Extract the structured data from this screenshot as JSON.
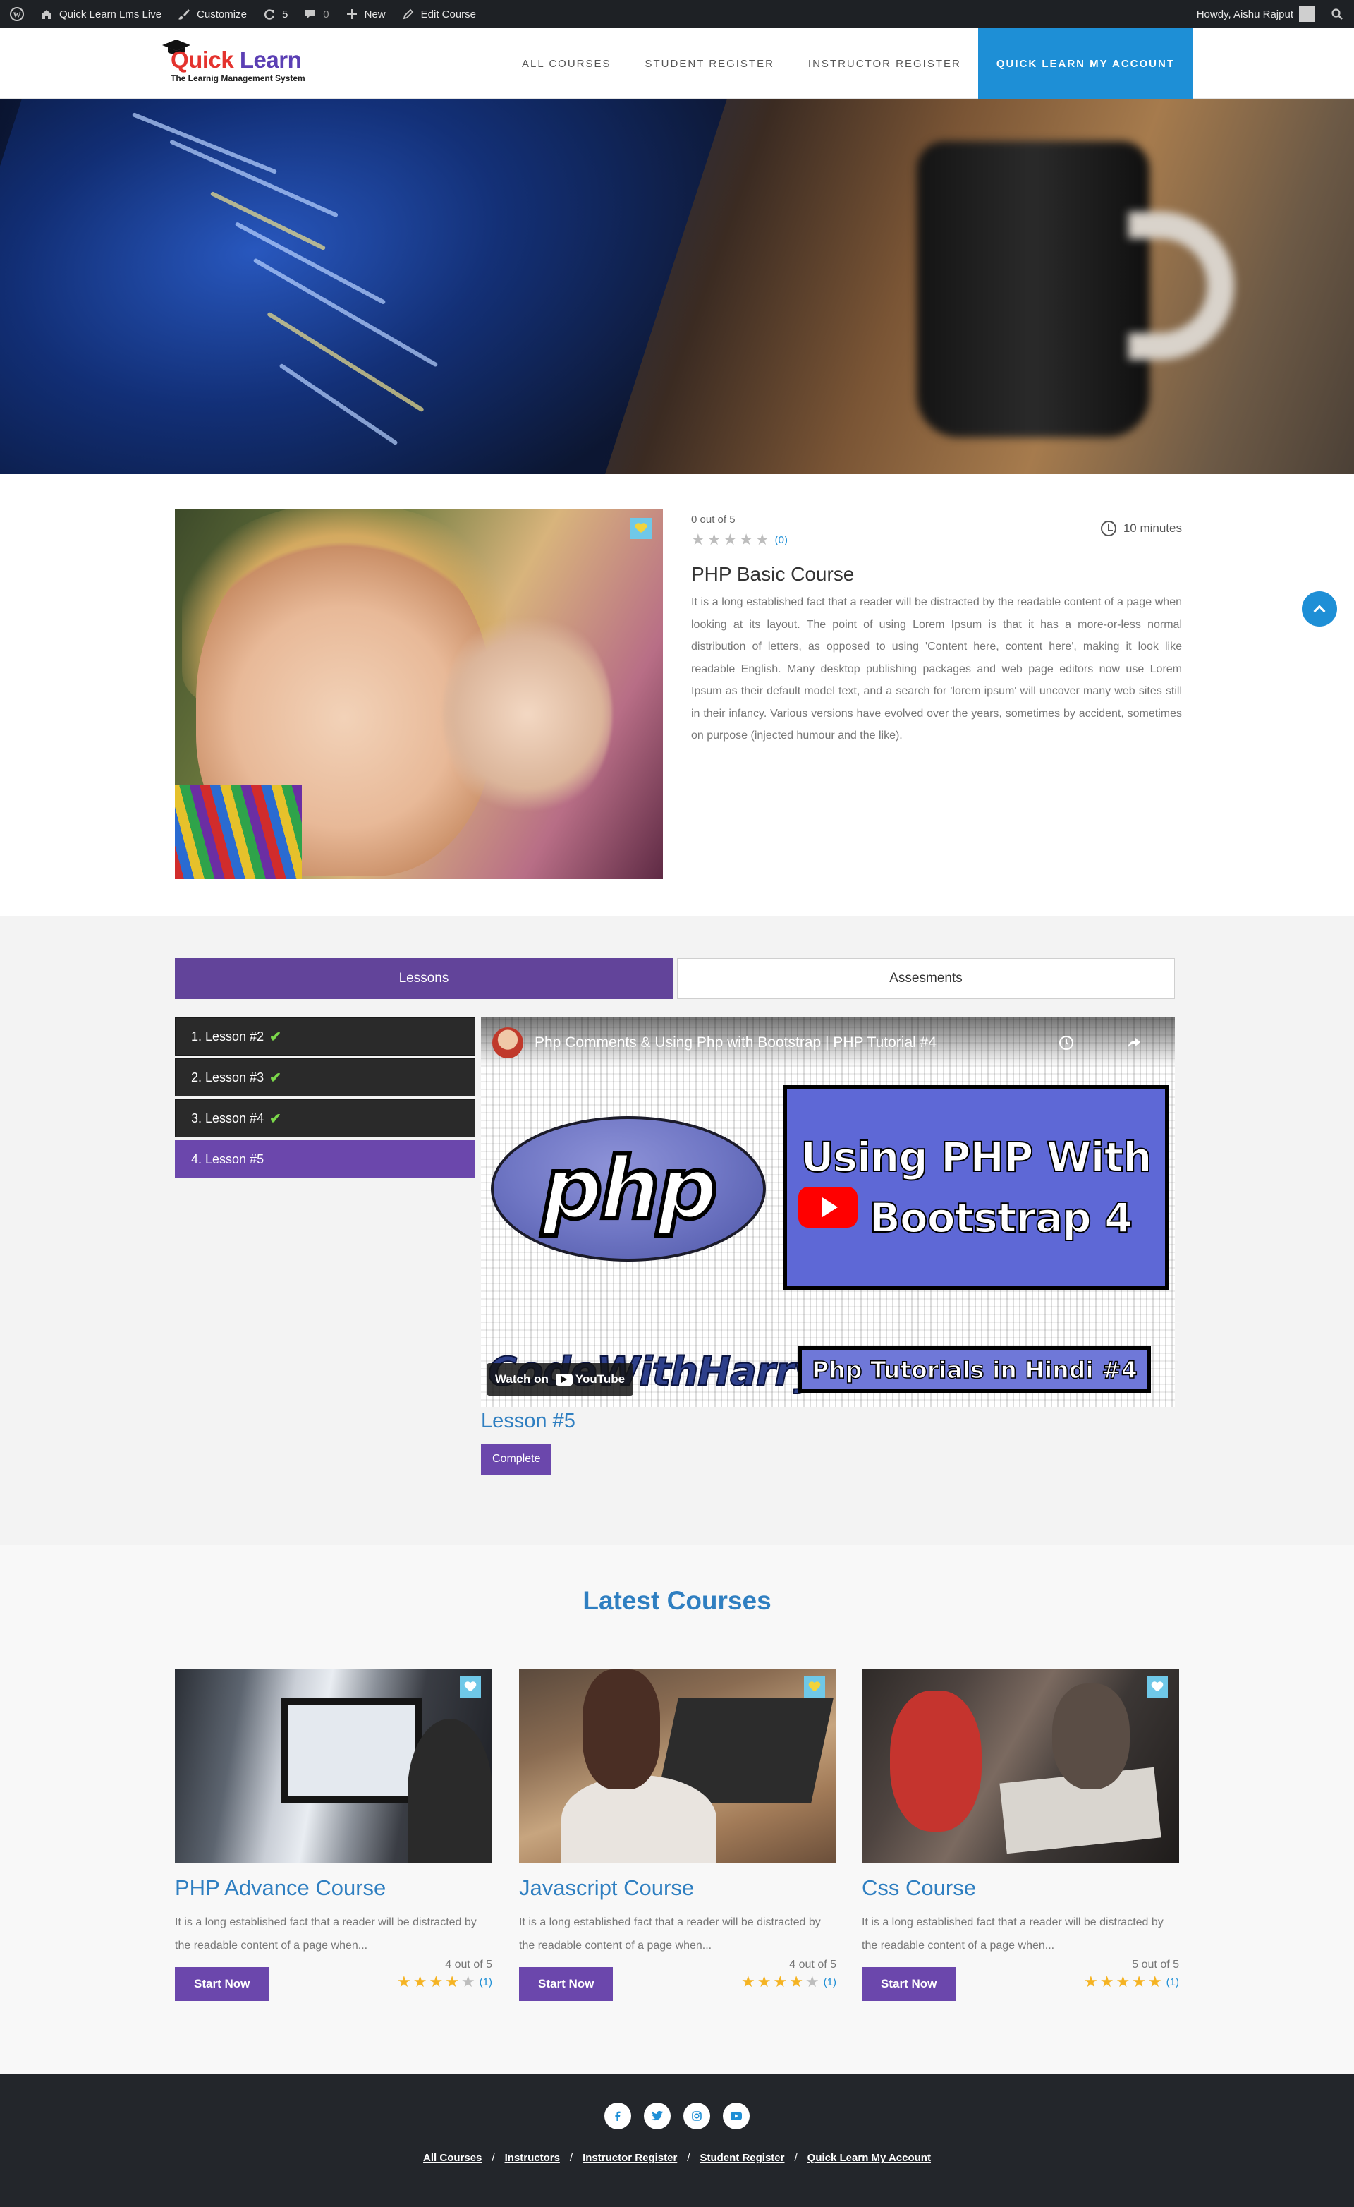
{
  "adminbar": {
    "site": "Quick Learn Lms Live",
    "customize": "Customize",
    "updates_count": "5",
    "comments_count": "0",
    "new": "New",
    "edit_course": "Edit Course",
    "howdy": "Howdy, Aishu Rajput"
  },
  "header": {
    "logo_title_a": "Quick ",
    "logo_title_b": "Learn",
    "logo_subtitle": "The Learnig Management System",
    "nav": [
      "ALL COURSES",
      "STUDENT REGISTER",
      "INSTRUCTOR REGISTER",
      "QUICK LEARN MY ACCOUNT"
    ]
  },
  "course": {
    "rating_text": "0 out of 5",
    "rating_count": "(0)",
    "rating_value": 0,
    "duration": "10 minutes",
    "title": "PHP Basic Course",
    "description": "It is a long established fact that a reader will be distracted by the readable content of a page when looking at its layout. The point of using Lorem Ipsum is that it has a more-or-less normal distribution of letters, as opposed to using 'Content here, content here', making it look like readable English. Many desktop publishing packages and web page editors now use Lorem Ipsum as their default model text, and a search for 'lorem ipsum' will uncover many web sites still in their infancy. Various versions have evolved over the years, sometimes by accident, sometimes on purpose (injected humour and the like)."
  },
  "tabs": {
    "lessons": "Lessons",
    "assessments": "Assesments"
  },
  "lessons": [
    {
      "label": "1. Lesson #2",
      "completed": true
    },
    {
      "label": "2. Lesson #3",
      "completed": true
    },
    {
      "label": "3. Lesson #4",
      "completed": true
    },
    {
      "label": "4. Lesson #5",
      "completed": false
    }
  ],
  "video": {
    "title": "Php Comments & Using Php with Bootstrap | PHP Tutorial #4",
    "php_text": "php",
    "line1": "Using PHP With",
    "line2": "Bootstrap 4",
    "channel": "CodeWithHarry",
    "series": "Php Tutorials in Hindi #4",
    "watch_on": "Watch on",
    "youtube": "YouTube"
  },
  "current_lesson": {
    "title": "Lesson #5",
    "complete_label": "Complete"
  },
  "latest": {
    "title": "Latest Courses",
    "cards": [
      {
        "title": "PHP Advance Course",
        "desc": "It is a long established fact that a reader will be distracted by the readable content of a page when...",
        "rating_text": "4 out of 5",
        "rating_value": 4,
        "count": "(1)",
        "button": "Start Now"
      },
      {
        "title": "Javascript Course",
        "desc": "It is a long established fact that a reader will be distracted by the readable content of a page when...",
        "rating_text": "4 out of 5",
        "rating_value": 4,
        "count": "(1)",
        "button": "Start Now"
      },
      {
        "title": "Css Course",
        "desc": "It is a long established fact that a reader will be distracted by the readable content of a page when...",
        "rating_text": "5 out of 5",
        "rating_value": 5,
        "count": "(1)",
        "button": "Start Now"
      }
    ]
  },
  "footer": {
    "socials": [
      "facebook-icon",
      "twitter-icon",
      "instagram-icon",
      "youtube-icon"
    ],
    "links": [
      "All Courses",
      "Instructors",
      "Instructor Register",
      "Student Register",
      "Quick Learn My Account"
    ],
    "separator": "/"
  },
  "colors": {
    "brand_blue": "#1e8fd6",
    "brand_purple": "#6b47ac",
    "title_blue": "#2f7fc1",
    "footer_bg": "#23262b",
    "star_gold": "#f5b322"
  }
}
